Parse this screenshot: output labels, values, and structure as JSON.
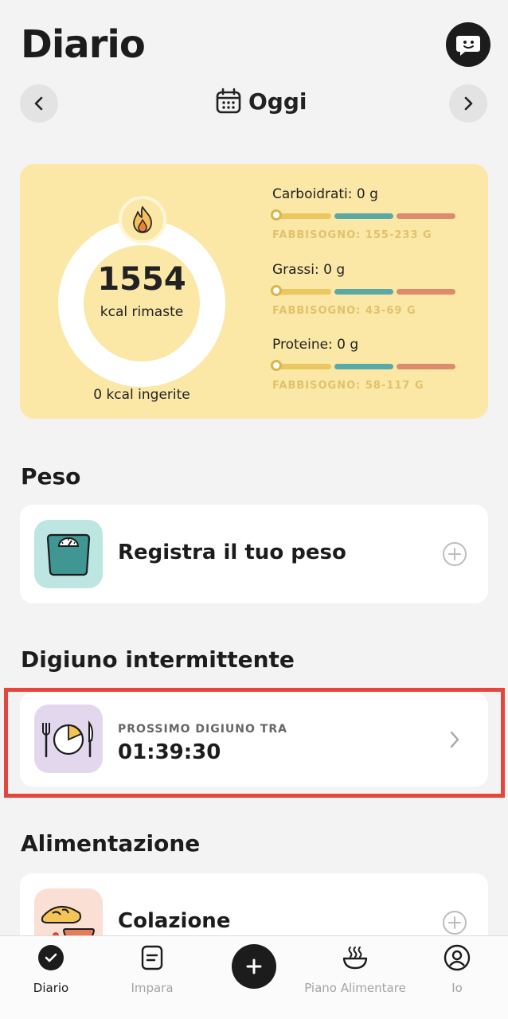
{
  "header": {
    "title": "Diario",
    "date_label": "Oggi"
  },
  "summary": {
    "kcal_remaining": "1554",
    "kcal_remaining_label": "kcal rimaste",
    "kcal_ingested": "0 kcal ingerite",
    "macros": [
      {
        "name": "Carboidrati: 0 g",
        "requirement": "FABBISOGNO: 155-233 G",
        "progress": 0
      },
      {
        "name": "Grassi: 0 g",
        "requirement": "FABBISOGNO: 43-69 G",
        "progress": 0
      },
      {
        "name": "Proteine: 0 g",
        "requirement": "FABBISOGNO: 58-117 G",
        "progress": 0
      }
    ],
    "colors": {
      "card": "#fbe7a6",
      "low": "#ebc761",
      "mid": "#5aa9a6",
      "high": "#de8a6c"
    }
  },
  "weight": {
    "section_title": "Peso",
    "card_label": "Registra il tuo peso",
    "icon": "scale-icon"
  },
  "fasting": {
    "section_title": "Digiuno intermittente",
    "caption": "PROSSIMO DIGIUNO TRA",
    "countdown": "01:39:30",
    "icon": "plate-clock-icon",
    "highlight_color": "#e5453a"
  },
  "nutrition": {
    "section_title": "Alimentazione",
    "meals": [
      {
        "label": "Colazione",
        "icon": "breakfast-icon"
      }
    ]
  },
  "tabbar": {
    "tabs": [
      {
        "label": "Diario",
        "icon": "check-circle-icon",
        "active": true
      },
      {
        "label": "Impara",
        "icon": "note-icon",
        "active": false
      },
      {
        "label": "Piano Alimentare",
        "icon": "bowl-icon",
        "active": false
      },
      {
        "label": "Io",
        "icon": "user-icon",
        "active": false
      }
    ],
    "add_icon": "plus-icon"
  }
}
